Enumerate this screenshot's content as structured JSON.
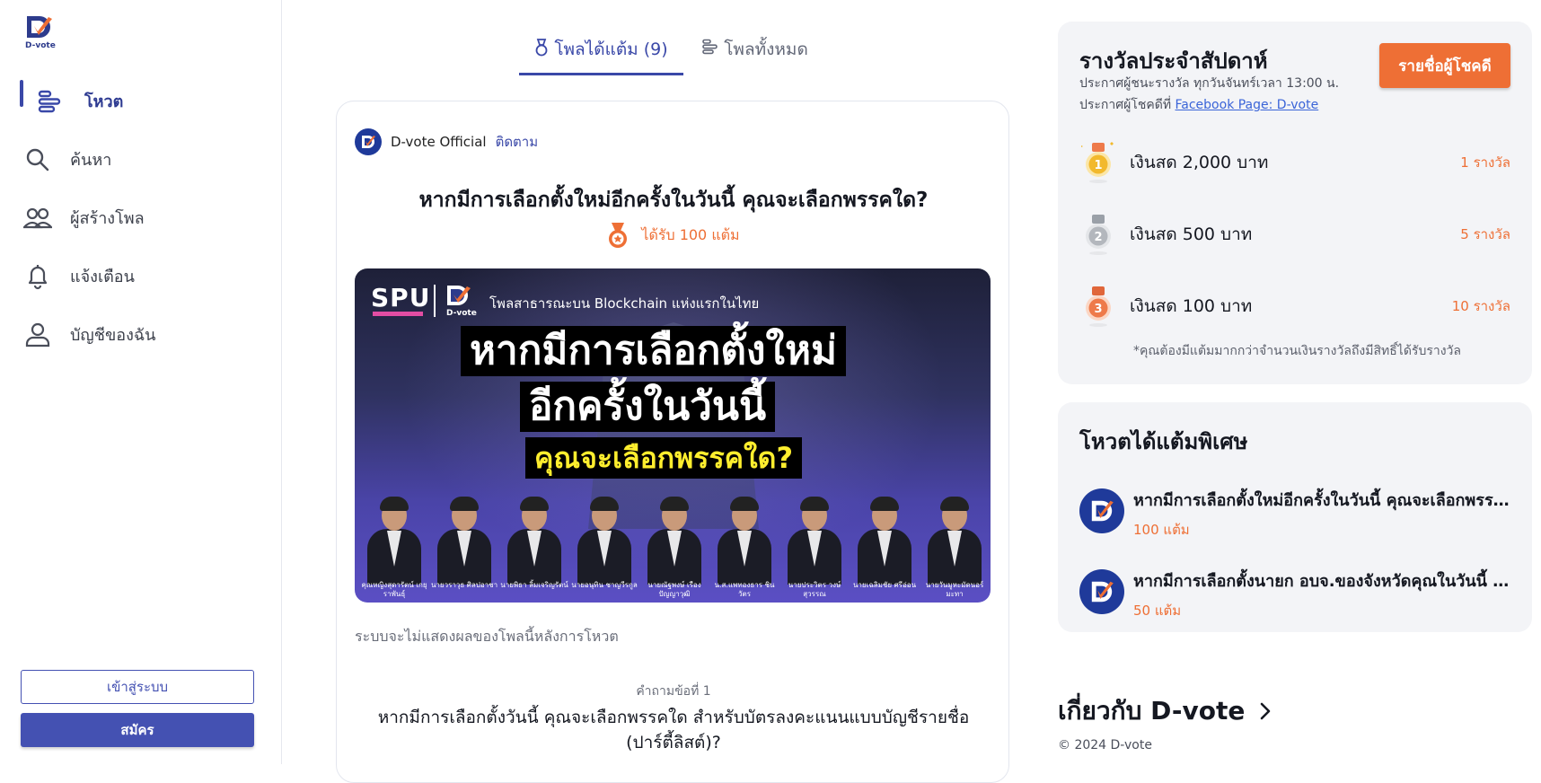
{
  "app": {
    "logo_text": "D-vote"
  },
  "sidebar": {
    "items": [
      {
        "label": "โหวต",
        "icon": "poll-icon",
        "active": true
      },
      {
        "label": "ค้นหา",
        "icon": "search-icon"
      },
      {
        "label": "ผู้สร้างโพล",
        "icon": "users-icon"
      },
      {
        "label": "แจ้งเตือน",
        "icon": "bell-icon"
      },
      {
        "label": "บัญชีของฉัน",
        "icon": "user-icon"
      }
    ],
    "login_label": "เข้าสู่ระบบ",
    "signup_label": "สมัคร"
  },
  "tabs": [
    {
      "label": "โพลได้แต้ม (9)",
      "active": true
    },
    {
      "label": "โพลทั้งหมด"
    }
  ],
  "post": {
    "author": "D-vote Official",
    "follow_label": "ติดตาม",
    "title": "หากมีการเลือกตั้งใหม่อีกครั้งในวันนี้ คุณจะเลือกพรรคใด?",
    "reward": "ได้รับ 100 แต้ม",
    "banner": {
      "brand": "SPU",
      "dvote": "D-vote",
      "tagline": "โพลสาธารณะบน Blockchain แห่งแรกในไทย",
      "line1": "หากมีการเลือกตั้งใหม่",
      "line2": "อีกครั้งในวันนี้",
      "line3": "คุณจะเลือกพรรคใด?",
      "people": [
        "คุณหญิงสุดารัตน์ เกยุราพันธุ์",
        "นายวราวุธ ศิลปอาชา",
        "นายพิธา ลิ้มเจริญรัตน์",
        "นายอนุทิน ชาญวีรกูล",
        "นายณัฐพงษ์ เรืองปัญญาวุฒิ",
        "น.ส.แพทองธาร ชินวัตร",
        "นายประวิตร วงษ์สุวรรณ",
        "นายเฉลิมชัย ศรีอ่อน",
        "นายวันมูหะมัดนอร์ มะทา"
      ]
    },
    "note": "ระบบจะไม่แสดงผลของโพลนี้หลังการโหวต",
    "question_number": "คำถามข้อที่ 1",
    "question_text": "หากมีการเลือกตั้งวันนี้ คุณจะเลือกพรรคใด สำหรับบัตรลงคะแนนแบบบัญชีรายชื่อ (ปาร์ตี้ลิสต์)?"
  },
  "weekly": {
    "title": "รางวัลประจำสัปดาห์",
    "sub1": "ประกาศผู้ชนะรางวัล ทุกวันจันทร์เวลา 13:00 น.",
    "sub2_prefix": "ประกาศผู้โชคดีที่ ",
    "sub2_link": "Facebook Page: D-vote",
    "lucky_button": "รายชื่อผู้โชคดี",
    "prizes": [
      {
        "rank": "1",
        "amount": "เงินสด 2,000 บาท",
        "count": "1 รางวัล",
        "color": "#f2b92d"
      },
      {
        "rank": "2",
        "amount": "เงินสด 500 บาท",
        "count": "5 รางวัล",
        "color": "#a9adb4"
      },
      {
        "rank": "3",
        "amount": "เงินสด 100 บาท",
        "count": "10 รางวัล",
        "color": "#ee7a4a"
      }
    ],
    "footnote": "*คุณต้องมีแต้มมากกว่าจำนวนเงินรางวัลถึงมีสิทธิ์ได้รับรางวัล"
  },
  "bonus": {
    "title": "โหวตได้แต้มพิเศษ",
    "items": [
      {
        "title": "หากมีการเลือกตั้งใหม่อีกครั้งในวันนี้ คุณจะเลือกพรรคใด?",
        "points": "100 แต้ม"
      },
      {
        "title": "หากมีการเลือกตั้งนายก อบจ.ของจังหวัดคุณในวันนี้ คุณจะเลือกใคร?",
        "points": "50 แต้ม"
      }
    ]
  },
  "about": {
    "label": "เกี่ยวกับ D-vote"
  },
  "footer": {
    "copyright": "© 2024 D-vote"
  },
  "colors": {
    "primary": "#3a48a8",
    "accent": "#ee6f35",
    "panel": "#f3f4f7"
  }
}
